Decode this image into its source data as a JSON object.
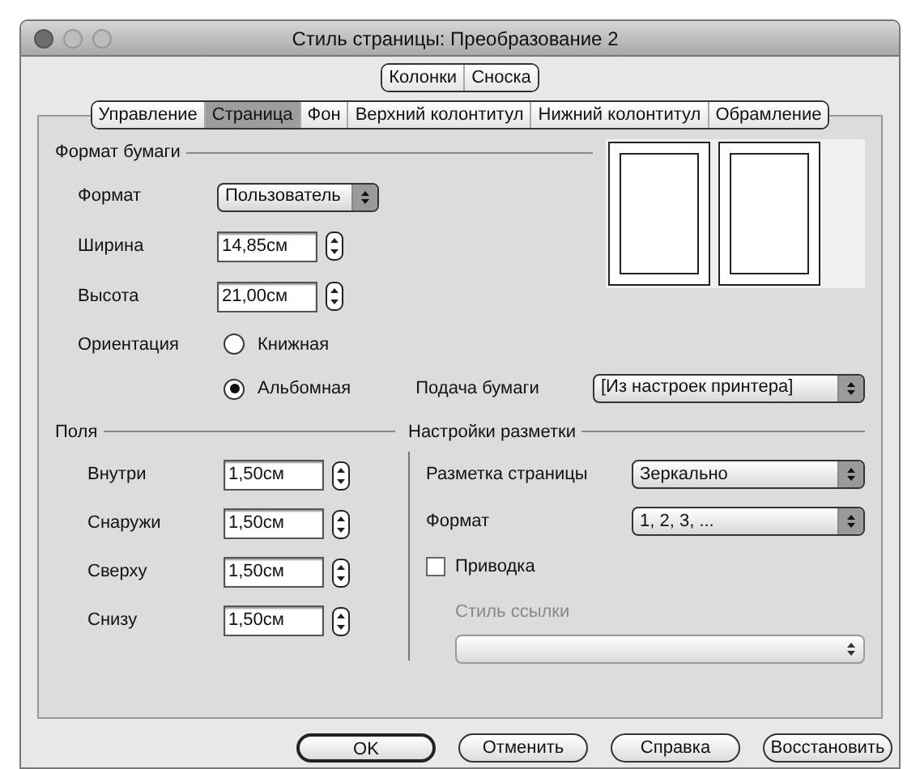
{
  "window": {
    "title": "Стиль страницы: Преобразование 2"
  },
  "tab_rows": [
    [
      {
        "label": "Колонки",
        "selected": false
      },
      {
        "label": "Сноска",
        "selected": false
      }
    ],
    [
      {
        "label": "Управление",
        "selected": false
      },
      {
        "label": "Страница",
        "selected": true
      },
      {
        "label": "Фон",
        "selected": false
      },
      {
        "label": "Верхний колонтитул",
        "selected": false
      },
      {
        "label": "Нижний колонтитул",
        "selected": false
      },
      {
        "label": "Обрамление",
        "selected": false
      }
    ]
  ],
  "paper_format": {
    "title": "Формат бумаги",
    "format": {
      "label": "Формат",
      "value": "Пользователь"
    },
    "size_fields": [
      {
        "label": "Ширина",
        "value": "14,85см"
      },
      {
        "label": "Высота",
        "value": "21,00см"
      }
    ],
    "orientation": {
      "label": "Ориентация",
      "options": [
        {
          "label": "Книжная",
          "selected": false
        },
        {
          "label": "Альбомная",
          "selected": true
        }
      ]
    },
    "paper_tray": {
      "label": "Подача бумаги",
      "value": "[Из настроек принтера]"
    }
  },
  "margins": {
    "title": "Поля",
    "fields": [
      {
        "label": "Внутри",
        "value": "1,50см"
      },
      {
        "label": "Снаружи",
        "value": "1,50см"
      },
      {
        "label": "Сверху",
        "value": "1,50см"
      },
      {
        "label": "Снизу",
        "value": "1,50см"
      }
    ]
  },
  "layout_settings": {
    "title": "Настройки разметки",
    "selects": [
      {
        "label": "Разметка страницы",
        "value": "Зеркально"
      },
      {
        "label": "Формат",
        "value": "1, 2, 3, ..."
      }
    ],
    "register": {
      "label": "Приводка",
      "checked": false
    },
    "reference_style": {
      "label": "Стиль ссылки",
      "disabled": true
    }
  },
  "buttons": [
    {
      "label": "OK",
      "default": true
    },
    {
      "label": "Отменить",
      "default": false
    },
    {
      "label": "Справка",
      "default": false
    },
    {
      "label": "Восстановить",
      "default": false
    }
  ]
}
